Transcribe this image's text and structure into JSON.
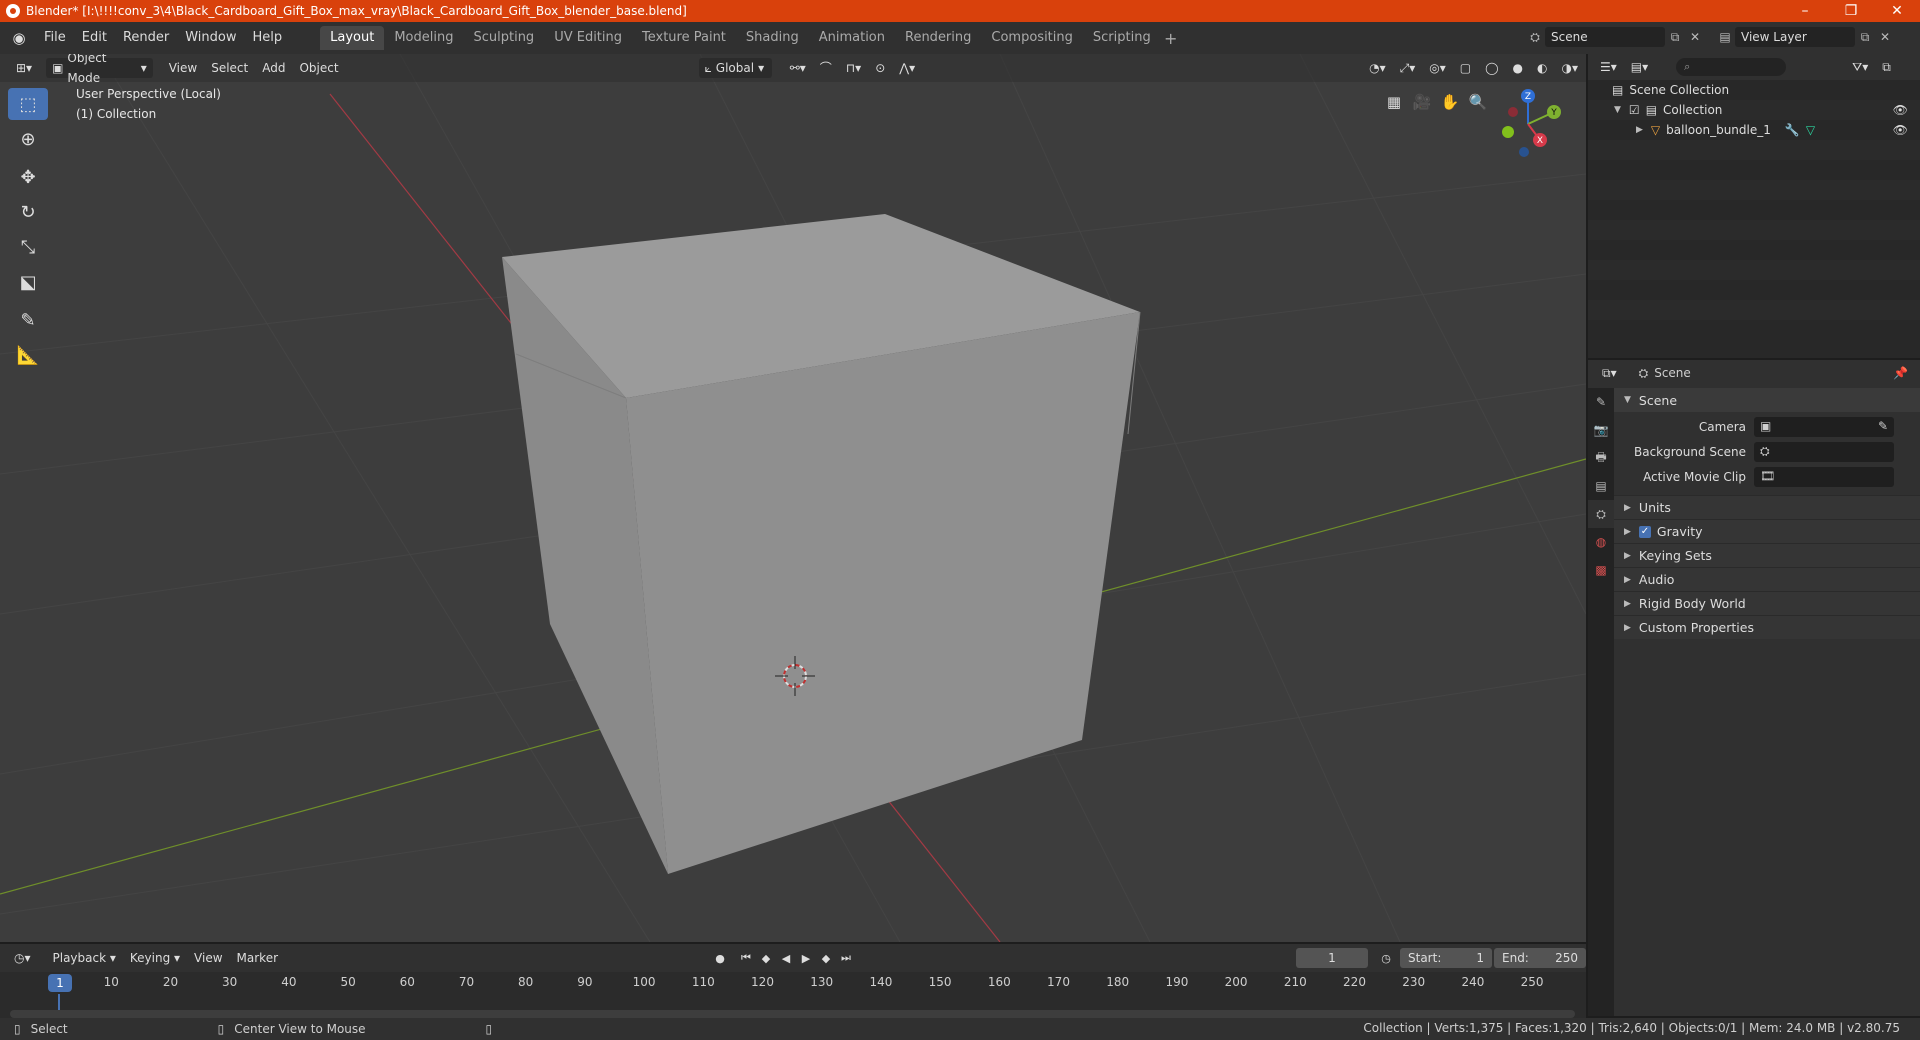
{
  "window": {
    "title": "Blender* [I:\\!!!!conv_3\\4\\Black_Cardboard_Gift_Box_max_vray\\Black_Cardboard_Gift_Box_blender_base.blend]",
    "min": "–",
    "max": "❐",
    "close": "✕"
  },
  "menu": [
    "File",
    "Edit",
    "Render",
    "Window",
    "Help"
  ],
  "workspaces": [
    "Layout",
    "Modeling",
    "Sculpting",
    "UV Editing",
    "Texture Paint",
    "Shading",
    "Animation",
    "Rendering",
    "Compositing",
    "Scripting"
  ],
  "active_workspace": "Layout",
  "scene_name": "Scene",
  "view_layer": "View Layer",
  "viewport": {
    "mode": "Object Mode",
    "menus": [
      "View",
      "Select",
      "Add",
      "Object"
    ],
    "transform": "Global",
    "info_line1": "User Perspective (Local)",
    "info_line2": "(1) Collection"
  },
  "gizmo": {
    "x": "X",
    "y": "Y",
    "z": "Z"
  },
  "timeline": {
    "menus": [
      "Playback",
      "Keying",
      "View",
      "Marker"
    ],
    "current_frame": "1",
    "start_label": "Start:",
    "start": "1",
    "end_label": "End:",
    "end": "250",
    "ticks": [
      "10",
      "20",
      "30",
      "40",
      "50",
      "60",
      "70",
      "80",
      "90",
      "100",
      "110",
      "120",
      "130",
      "140",
      "150",
      "160",
      "170",
      "180",
      "190",
      "200",
      "210",
      "220",
      "230",
      "240",
      "250"
    ],
    "frame_marker": "1"
  },
  "status": {
    "select": "Select",
    "center_view": "Center View to Mouse",
    "stats": "Collection | Verts:1,375 | Faces:1,320 | Tris:2,640 | Objects:0/1 | Mem: 24.0 MB | v2.80.75"
  },
  "outliner": {
    "scene_collection": "Scene Collection",
    "collection": "Collection",
    "object": "balloon_bundle_1"
  },
  "properties": {
    "header": "Scene",
    "panel": "Scene",
    "camera_label": "Camera",
    "background_scene_label": "Background Scene",
    "active_clip_label": "Active Movie Clip",
    "subpanels": [
      "Units",
      "Gravity",
      "Keying Sets",
      "Audio",
      "Rigid Body World",
      "Custom Properties"
    ]
  }
}
